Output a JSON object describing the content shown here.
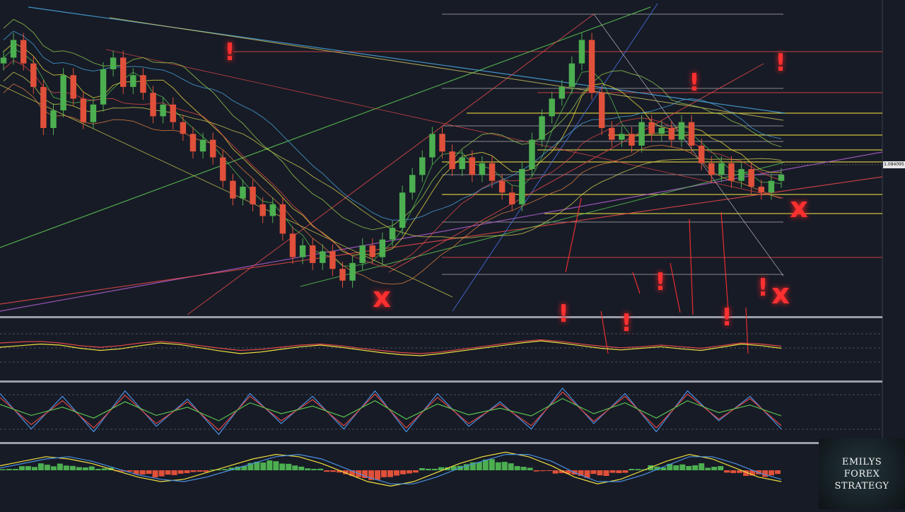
{
  "chart_data": [
    {
      "type": "line",
      "panel": "price",
      "title": "",
      "xlabel": "",
      "ylabel": "",
      "last_price_label": "1.084095",
      "candles_visible": true,
      "grid": false,
      "levels_note": "horizontal support/resistance lines",
      "warning_markers": [
        "!",
        "!",
        "!",
        "!",
        "!",
        "!",
        "!",
        "!"
      ],
      "cross_markers": [
        "x",
        "x",
        "x"
      ],
      "close": [
        1.104,
        1.107,
        1.103,
        1.099,
        1.092,
        1.095,
        1.101,
        1.097,
        1.093,
        1.096,
        1.102,
        1.104,
        1.099,
        1.101,
        1.098,
        1.094,
        1.096,
        1.093,
        1.091,
        1.088,
        1.09,
        1.087,
        1.083,
        1.08,
        1.082,
        1.079,
        1.077,
        1.079,
        1.074,
        1.07,
        1.072,
        1.069,
        1.071,
        1.068,
        1.066,
        1.069,
        1.072,
        1.07,
        1.073,
        1.075,
        1.081,
        1.084,
        1.087,
        1.091,
        1.088,
        1.085,
        1.087,
        1.084,
        1.086,
        1.083,
        1.081,
        1.079,
        1.085,
        1.09,
        1.094,
        1.097,
        1.099,
        1.103,
        1.107,
        1.098,
        1.092,
        1.09,
        1.091,
        1.089,
        1.093,
        1.091,
        1.092,
        1.09,
        1.093,
        1.089,
        1.086,
        1.084,
        1.086,
        1.083,
        1.085,
        1.082,
        1.081,
        1.083,
        1.084
      ]
    },
    {
      "type": "line",
      "panel": "oscillator-1",
      "series": [
        {
          "color": "#f0e040",
          "values": [
            0.52,
            0.55,
            0.58,
            0.56,
            0.5,
            0.46,
            0.49,
            0.55,
            0.6,
            0.57,
            0.51,
            0.45,
            0.4,
            0.43,
            0.48,
            0.53,
            0.56,
            0.52,
            0.47,
            0.42,
            0.38,
            0.36,
            0.4,
            0.45,
            0.5,
            0.55,
            0.6,
            0.64,
            0.6,
            0.55,
            0.5,
            0.47,
            0.5,
            0.53,
            0.49,
            0.46,
            0.52,
            0.58,
            0.55,
            0.5
          ]
        },
        {
          "color": "#e04848",
          "values": [
            0.6,
            0.62,
            0.63,
            0.6,
            0.55,
            0.52,
            0.55,
            0.6,
            0.63,
            0.6,
            0.55,
            0.5,
            0.46,
            0.48,
            0.52,
            0.56,
            0.58,
            0.55,
            0.5,
            0.46,
            0.42,
            0.4,
            0.43,
            0.48,
            0.53,
            0.58,
            0.63,
            0.66,
            0.63,
            0.58,
            0.54,
            0.51,
            0.53,
            0.56,
            0.53,
            0.5,
            0.55,
            0.6,
            0.58,
            0.54
          ]
        }
      ]
    },
    {
      "type": "line",
      "panel": "oscillator-2",
      "series": [
        {
          "color": "#4a90e2",
          "values": [
            0.85,
            0.2,
            0.8,
            0.15,
            0.9,
            0.25,
            0.75,
            0.1,
            0.85,
            0.3,
            0.8,
            0.2,
            0.9,
            0.15,
            0.85,
            0.25,
            0.7,
            0.2,
            0.95,
            0.3,
            0.85,
            0.15,
            0.9,
            0.35,
            0.8,
            0.2
          ]
        },
        {
          "color": "#e04848",
          "values": [
            0.78,
            0.28,
            0.72,
            0.22,
            0.82,
            0.3,
            0.7,
            0.18,
            0.8,
            0.35,
            0.74,
            0.26,
            0.84,
            0.22,
            0.78,
            0.3,
            0.66,
            0.26,
            0.88,
            0.34,
            0.8,
            0.22,
            0.84,
            0.38,
            0.76,
            0.26
          ]
        },
        {
          "color": "#58c050",
          "values": [
            0.65,
            0.45,
            0.6,
            0.4,
            0.7,
            0.45,
            0.6,
            0.35,
            0.68,
            0.48,
            0.62,
            0.42,
            0.72,
            0.38,
            0.66,
            0.46,
            0.58,
            0.44,
            0.76,
            0.48,
            0.68,
            0.4,
            0.72,
            0.5,
            0.64,
            0.44
          ]
        }
      ]
    },
    {
      "type": "bar",
      "panel": "macd",
      "histogram": [
        0.1,
        0.3,
        0.5,
        0.6,
        0.4,
        0.2,
        -0.1,
        -0.3,
        -0.5,
        -0.4,
        -0.2,
        0.1,
        0.3,
        0.6,
        0.7,
        0.5,
        0.2,
        -0.2,
        -0.5,
        -0.7,
        -0.5,
        -0.3,
        0.2,
        0.4,
        0.6,
        0.8,
        0.6,
        0.3,
        -0.1,
        -0.4,
        -0.6,
        -0.4,
        -0.2,
        0.1,
        0.4,
        0.7,
        0.6,
        0.3,
        -0.2,
        -0.4,
        -0.5
      ],
      "series": [
        {
          "color": "#f0e040",
          "values": [
            0.2,
            0.4,
            0.6,
            0.5,
            0.3,
            0.0,
            -0.3,
            -0.5,
            -0.4,
            -0.1,
            0.2,
            0.5,
            0.7,
            0.6,
            0.3,
            -0.1,
            -0.5,
            -0.7,
            -0.5,
            -0.1,
            0.3,
            0.6,
            0.8,
            0.6,
            0.2,
            -0.3,
            -0.6,
            -0.4,
            0.0,
            0.4,
            0.7,
            0.5,
            0.1,
            -0.3,
            -0.5
          ]
        },
        {
          "color": "#4a90e2",
          "values": [
            0.1,
            0.3,
            0.5,
            0.6,
            0.4,
            0.1,
            -0.2,
            -0.4,
            -0.5,
            -0.3,
            0.0,
            0.3,
            0.6,
            0.7,
            0.5,
            0.1,
            -0.3,
            -0.6,
            -0.6,
            -0.3,
            0.1,
            0.4,
            0.7,
            0.7,
            0.4,
            -0.1,
            -0.5,
            -0.5,
            -0.2,
            0.2,
            0.6,
            0.6,
            0.3,
            -0.1,
            -0.4
          ]
        }
      ]
    }
  ],
  "branding": {
    "line1": "EMILYS",
    "line2": "FOREX",
    "line3": "STRATEGY"
  },
  "colors": {
    "background": "#171b26",
    "candle_up": "#4caf50",
    "candle_down": "#e0503a",
    "warning": "#ff3030",
    "level_yellow": "#f0e040",
    "level_red": "#e04848",
    "level_white": "#c8c8c8"
  }
}
